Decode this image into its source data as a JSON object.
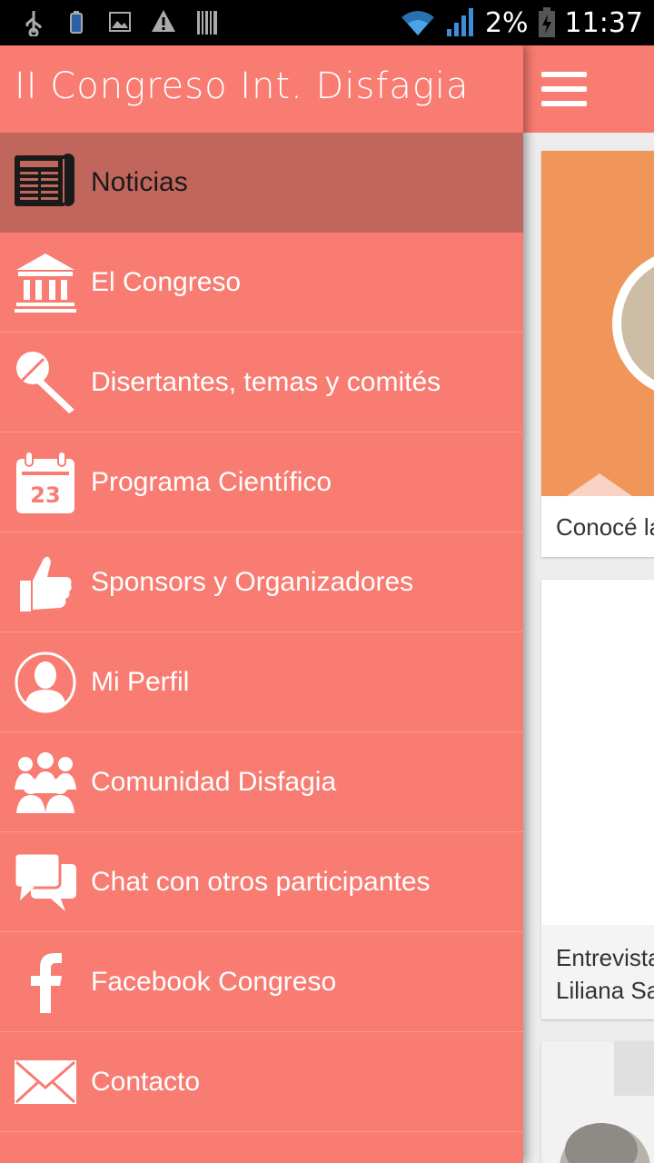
{
  "status_bar": {
    "battery": "2%",
    "time": "11:37"
  },
  "drawer": {
    "title": "II Congreso Int. Disfagia",
    "items": [
      {
        "label": "Noticias",
        "icon": "newspaper-icon",
        "active": true
      },
      {
        "label": "El Congreso",
        "icon": "institution-icon"
      },
      {
        "label": "Disertantes, temas y comités",
        "icon": "microphone-icon"
      },
      {
        "label": "Programa Científico",
        "icon": "calendar-icon"
      },
      {
        "label": "Sponsors y Organizadores",
        "icon": "thumbs-up-icon"
      },
      {
        "label": "Mi Perfil",
        "icon": "profile-icon"
      },
      {
        "label": "Comunidad Disfagia",
        "icon": "community-icon"
      },
      {
        "label": "Chat con otros participantes",
        "icon": "chat-icon"
      },
      {
        "label": "Facebook Congreso",
        "icon": "facebook-icon"
      },
      {
        "label": "Contacto",
        "icon": "mail-icon"
      }
    ]
  },
  "main": {
    "cards": [
      {
        "text": "Conocé la"
      },
      {
        "text_line1": "Entrevista",
        "text_line2": "Liliana Sa"
      }
    ]
  },
  "colors": {
    "brand": "#f87c72",
    "active_item": "#c1665c",
    "card_accent": "#f0965a"
  }
}
